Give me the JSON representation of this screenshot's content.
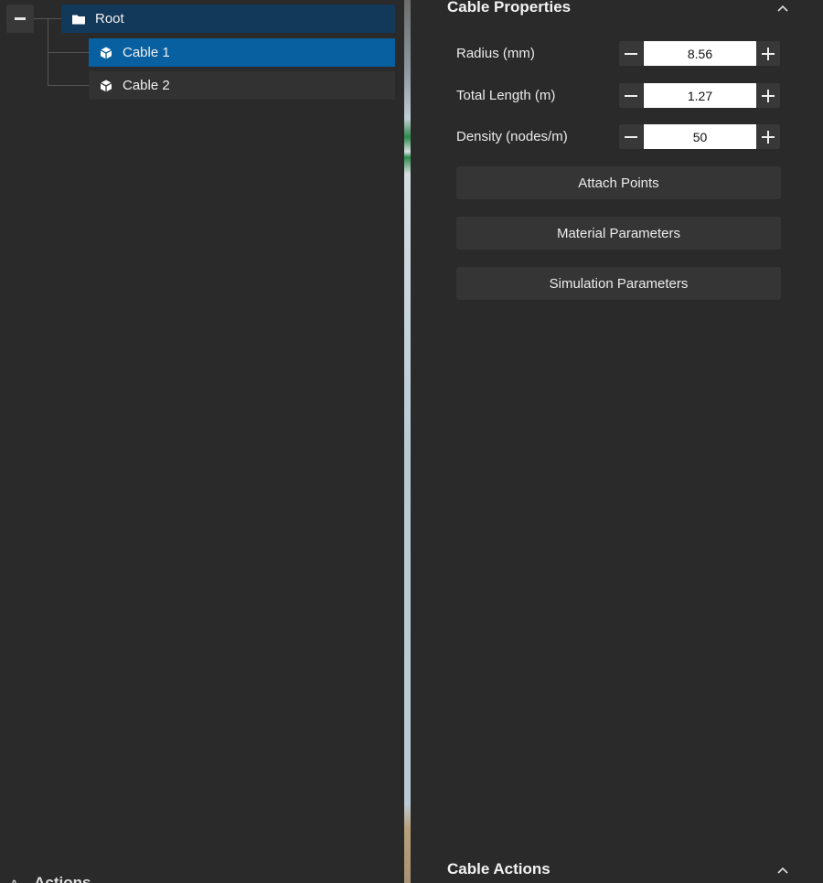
{
  "tree": {
    "root_label": "Root",
    "items": [
      {
        "label": "Cable 1",
        "selected": true
      },
      {
        "label": "Cable 2",
        "selected": false
      }
    ]
  },
  "left_footer": {
    "label": "Actions"
  },
  "properties": {
    "title": "Cable Properties",
    "fields": [
      {
        "label": "Radius (mm)",
        "value": "8.56"
      },
      {
        "label": "Total Length (m)",
        "value": "1.27"
      },
      {
        "label": "Density (nodes/m)",
        "value": "50"
      }
    ],
    "buttons": {
      "attach_points": "Attach Points",
      "material_parameters": "Material Parameters",
      "simulation_parameters": "Simulation Parameters"
    }
  },
  "actions_section": {
    "title": "Cable Actions"
  },
  "colors": {
    "panel_bg": "#2a2a2a",
    "selected_row": "#0960a0",
    "root_row": "#12385a"
  }
}
